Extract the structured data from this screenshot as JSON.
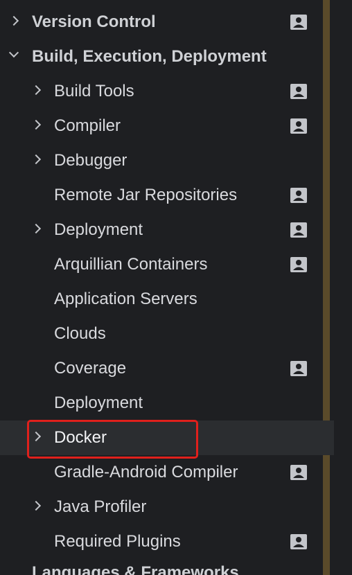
{
  "tree": {
    "items": [
      {
        "label": "Version Control",
        "level": 0,
        "arrow": "right",
        "bold": true,
        "badge": true
      },
      {
        "label": "Build, Execution, Deployment",
        "level": 0,
        "arrow": "down",
        "bold": true,
        "badge": false
      },
      {
        "label": "Build Tools",
        "level": 1,
        "arrow": "right",
        "bold": false,
        "badge": true
      },
      {
        "label": "Compiler",
        "level": 1,
        "arrow": "right",
        "bold": false,
        "badge": true
      },
      {
        "label": "Debugger",
        "level": 1,
        "arrow": "right",
        "bold": false,
        "badge": false
      },
      {
        "label": "Remote Jar Repositories",
        "level": 1,
        "arrow": "none",
        "bold": false,
        "badge": true
      },
      {
        "label": "Deployment",
        "level": 1,
        "arrow": "right",
        "bold": false,
        "badge": true
      },
      {
        "label": "Arquillian Containers",
        "level": 1,
        "arrow": "none",
        "bold": false,
        "badge": true
      },
      {
        "label": "Application Servers",
        "level": 1,
        "arrow": "none",
        "bold": false,
        "badge": false
      },
      {
        "label": "Clouds",
        "level": 1,
        "arrow": "none",
        "bold": false,
        "badge": false
      },
      {
        "label": "Coverage",
        "level": 1,
        "arrow": "none",
        "bold": false,
        "badge": true
      },
      {
        "label": "Deployment",
        "level": 1,
        "arrow": "none",
        "bold": false,
        "badge": false
      },
      {
        "label": "Docker",
        "level": 1,
        "arrow": "right",
        "bold": false,
        "badge": false,
        "selected": true
      },
      {
        "label": "Gradle-Android Compiler",
        "level": 1,
        "arrow": "none",
        "bold": false,
        "badge": true
      },
      {
        "label": "Java Profiler",
        "level": 1,
        "arrow": "right",
        "bold": false,
        "badge": false
      },
      {
        "label": "Required Plugins",
        "level": 1,
        "arrow": "none",
        "bold": false,
        "badge": true
      }
    ],
    "cutoff_label": "Languages & Frameworks"
  },
  "colors": {
    "background": "#1e1f22",
    "selected_row": "#2b2d30",
    "text": "#d9dade",
    "badge": "#c3c5ca",
    "highlight": "#e0201c",
    "scroll_stripe": "#5a4a2a"
  },
  "icons": {
    "expand": "chevron-right-icon",
    "collapse": "chevron-down-icon",
    "project_level": "user-card-icon"
  }
}
